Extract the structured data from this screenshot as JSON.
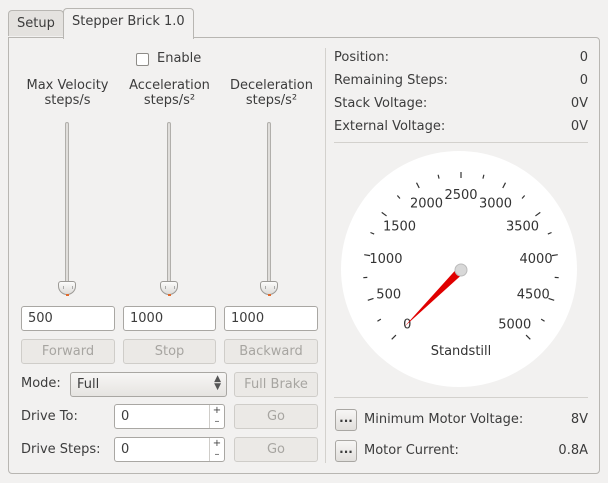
{
  "tabs": [
    {
      "label": "Setup"
    },
    {
      "label": "Stepper Brick 1.0"
    }
  ],
  "enable": {
    "label": "Enable",
    "checked": false
  },
  "sliders": {
    "max_velocity": {
      "label_line1": "Max Velocity",
      "label_line2": "steps/s",
      "value": "500"
    },
    "acceleration": {
      "label_line1": "Acceleration",
      "label_line2": "steps/s²",
      "value": "1000"
    },
    "deceleration": {
      "label_line1": "Deceleration",
      "label_line2": "steps/s²",
      "value": "1000"
    }
  },
  "buttons": {
    "forward": "Forward",
    "stop": "Stop",
    "backward": "Backward",
    "full_brake": "Full Brake",
    "go_drive_to": "Go",
    "go_drive_steps": "Go",
    "ellipsis": "..."
  },
  "mode": {
    "label": "Mode:",
    "selected": "Full"
  },
  "drive_to": {
    "label": "Drive To:",
    "value": "0"
  },
  "drive_steps": {
    "label": "Drive Steps:",
    "value": "0"
  },
  "status": {
    "position": {
      "label": "Position:",
      "value": "0"
    },
    "remaining_steps": {
      "label": "Remaining Steps:",
      "value": "0"
    },
    "stack_voltage": {
      "label": "Stack Voltage:",
      "value": "0V"
    },
    "external_voltage": {
      "label": "External Voltage:",
      "value": "0V"
    }
  },
  "gauge": {
    "tick_labels": [
      "0",
      "500",
      "1000",
      "1500",
      "2000",
      "2500",
      "3000",
      "3500",
      "4000",
      "4500",
      "5000"
    ],
    "caption": "Standstill",
    "value": 0,
    "min": 0,
    "max": 5000,
    "needle_color": "#e00000"
  },
  "min_motor_voltage": {
    "label": "Minimum Motor Voltage:",
    "value": "8V"
  },
  "motor_current": {
    "label": "Motor Current:",
    "value": "0.8A"
  }
}
